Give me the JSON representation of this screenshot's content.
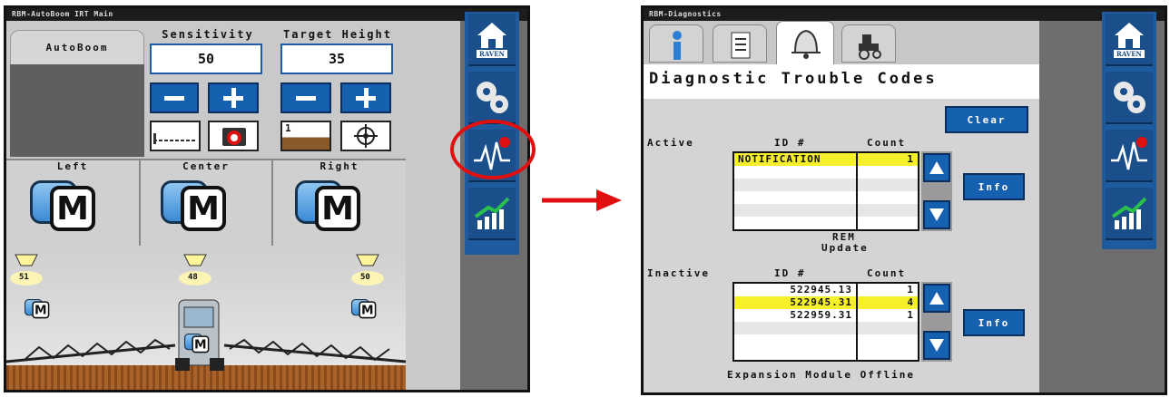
{
  "left_screen": {
    "title": "RBM-AutoBoom IRT Main",
    "tab_label": "AutoBoom",
    "sensitivity": {
      "label": "Sensitivity",
      "value": "50"
    },
    "target_height": {
      "label": "Target Height",
      "value": "35"
    },
    "sections": [
      {
        "label": "Left"
      },
      {
        "label": "Center"
      },
      {
        "label": "Right"
      }
    ],
    "mode_letter": "M",
    "sensor_heights": [
      "51",
      "48",
      "50"
    ],
    "preset_label": "1"
  },
  "right_screen": {
    "title": "RBM-Diagnostics",
    "heading": "Diagnostic Trouble Codes",
    "clear_label": "Clear",
    "active_label": "Active",
    "inactive_label": "Inactive",
    "id_header": "ID #",
    "count_header": "Count",
    "active_rows": [
      {
        "id": "NOTIFICATION",
        "count": "1",
        "highlight": true
      }
    ],
    "inactive_rows": [
      {
        "id": "522945.13",
        "count": "1",
        "highlight": false
      },
      {
        "id": "522945.31",
        "count": "4",
        "highlight": true
      },
      {
        "id": "522959.31",
        "count": "1",
        "highlight": false
      }
    ],
    "info_label": "Info",
    "source_name": "REM",
    "source_status": "Update",
    "footer": "Expansion Module Offline"
  },
  "raven_logo": "RAVEN",
  "icons": {
    "home": "home-icon",
    "settings": "gears-icon",
    "diagnostics": "diagnostics-waveform-icon",
    "performance": "performance-chart-icon"
  },
  "colors": {
    "accent_blue": "#1660b0",
    "highlight_yellow": "#f5f02a",
    "callout_red": "#e01010"
  }
}
